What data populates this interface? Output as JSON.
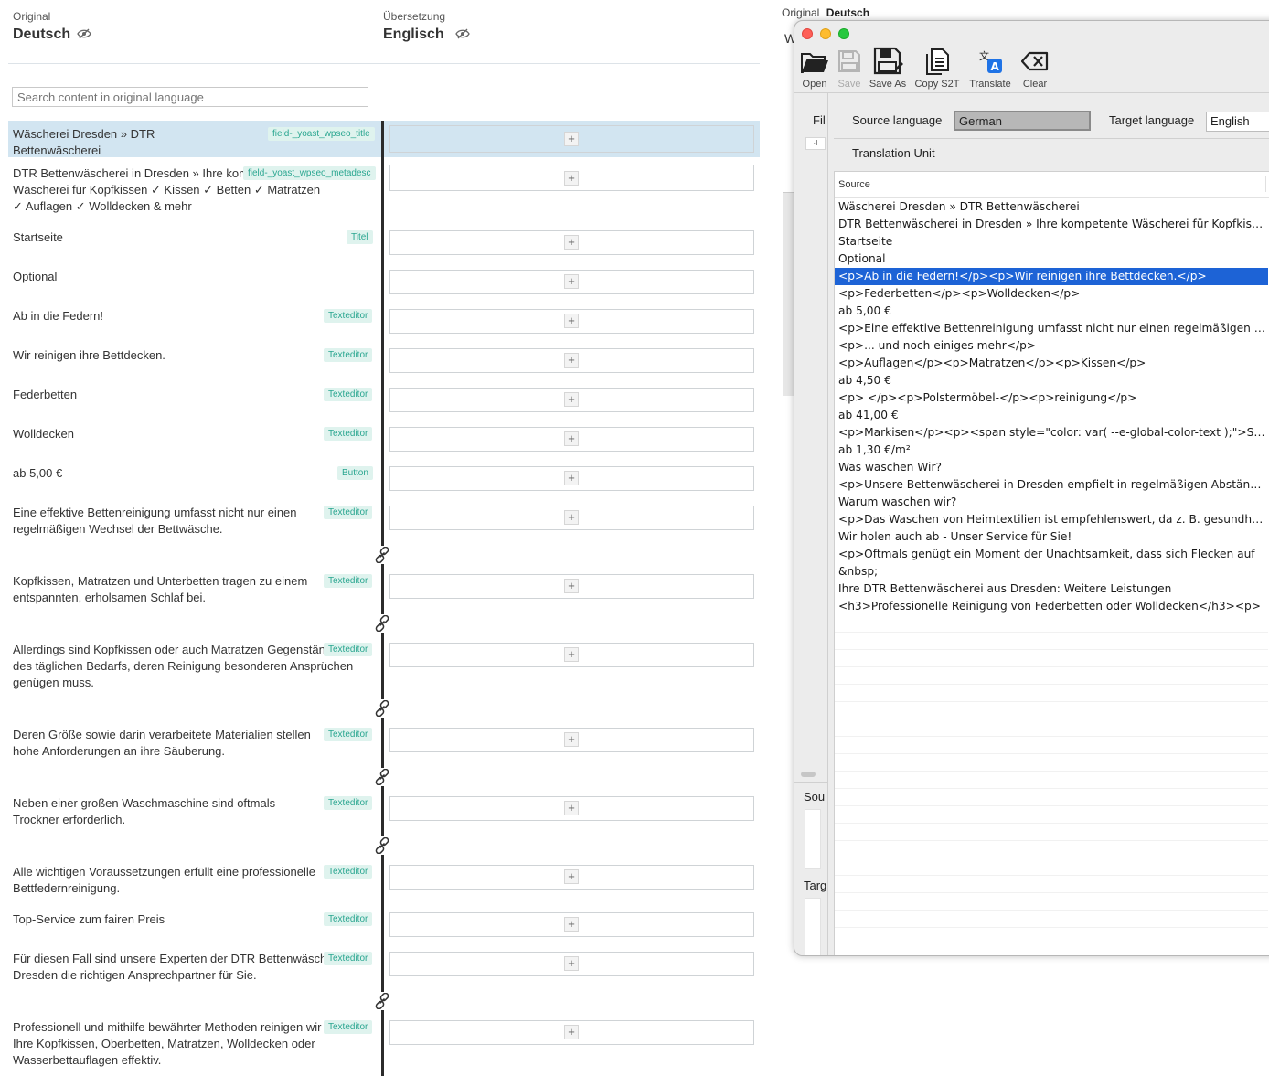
{
  "header": {
    "original_label": "Original",
    "original_lang": "Deutsch",
    "translation_label": "Übersetzung",
    "translation_lang": "Englisch"
  },
  "search": {
    "placeholder": "Search content in original language"
  },
  "segments": [
    {
      "text": "Wäscherei Dresden » DTR Bettenwäscherei",
      "tag": "field-_yoast_wpseo_title"
    },
    {
      "text": "DTR Bettenwäscherei in Dresden » Ihre kompetente Wäscherei für Kopfkissen ✓ Kissen ✓ Betten ✓ Matratzen ✓ Auflagen ✓ Wolldecken & mehr",
      "tag": "field-_yoast_wpseo_metadesc"
    },
    {
      "text": "Startseite",
      "tag": "Titel"
    },
    {
      "text": "Optional",
      "tag": ""
    },
    {
      "text": "Ab in die Federn!",
      "tag": "Texteditor"
    },
    {
      "text": "Wir reinigen ihre Bettdecken.",
      "tag": "Texteditor"
    },
    {
      "text": "Federbetten",
      "tag": "Texteditor"
    },
    {
      "text": "Wolldecken",
      "tag": "Texteditor"
    },
    {
      "text": "ab 5,00 €",
      "tag": "Button"
    },
    {
      "text": "Eine effektive Bettenreinigung umfasst nicht nur einen regelmäßigen Wechsel der Bettwäsche.",
      "tag": "Texteditor"
    },
    {
      "text": "Kopfkissen, Matratzen und Unterbetten tragen zu einem entspannten, erholsamen Schlaf bei.",
      "tag": "Texteditor"
    },
    {
      "text": "Allerdings sind Kopfkissen oder auch Matratzen Gegenstände des täglichen Bedarfs, deren Reinigung besonderen Ansprüchen genügen muss.",
      "tag": "Texteditor"
    },
    {
      "text": "Deren Größe sowie darin verarbeitete Materialien stellen hohe Anforderungen an ihre Säuberung.",
      "tag": "Texteditor"
    },
    {
      "text": "Neben einer großen Waschmaschine sind oftmals Trockner erforderlich.",
      "tag": "Texteditor"
    },
    {
      "text": "Alle wichtigen Voraussetzungen erfüllt eine professionelle Bettfedernreinigung.",
      "tag": "Texteditor"
    },
    {
      "text": "Top-Service zum fairen Preis",
      "tag": "Texteditor"
    },
    {
      "text": "Für diesen Fall sind unsere Experten der DTR Bettenwäscherei in Dresden die richtigen Ansprechpartner für Sie.",
      "tag": "Texteditor"
    },
    {
      "text": "Professionell und mithilfe bewährter Methoden reinigen wir Ihre Kopfkissen, Oberbetten, Matratzen, Wolldecken oder Wasserbettauflagen effektiv.",
      "tag": "Texteditor"
    }
  ],
  "plus_label": "+",
  "app": {
    "behind_title_label": "Original",
    "behind_title_lang": "Deutsch",
    "toolbar": {
      "open": "Open",
      "save": "Save",
      "save_as": "Save As",
      "copy_s2t": "Copy S2T",
      "translate": "Translate",
      "clear": "Clear"
    },
    "source_language_label": "Source language",
    "source_language_value": "German",
    "target_language_label": "Target language",
    "target_language_value": "English",
    "translation_unit_label": "Translation Unit",
    "source_column_header": "Source",
    "side_fil": "Fil",
    "side_sou": "Sou",
    "side_targ": "Targ",
    "rows": [
      "Wäscherei Dresden » DTR Bettenwäscherei",
      "DTR Bettenwäscherei in Dresden » Ihre kompetente Wäscherei für Kopfkissen ✓ Kissen",
      "Startseite",
      "Optional",
      "<p>Ab in die Federn!</p><p>Wir reinigen ihre Bettdecken.</p>",
      "<p>Federbetten</p><p>Wolldecken</p>",
      "ab 5,00 €",
      "<p>Eine effektive Bettenreinigung umfasst nicht nur einen regelmäßigen Wechsel der Bettwäsche.",
      "<p>... und noch einiges mehr</p>",
      "<p>Auflagen</p><p>Matratzen</p><p>Kissen</p>",
      "ab 4,50 €",
      "<p> </p><p>Polstermöbel-</p><p>reinigung</p>",
      "ab 41,00 €",
      "<p>Markisen</p><p><span style=\"color: var( --e-global-color-text );\">Sonnenschutz",
      "ab 1,30 €/m²",
      "Was waschen Wir?",
      "<p>Unsere Bettenwäscherei in Dresden empfielt in regelmäßigen Abständen",
      "Warum waschen wir?",
      "<p>Das Waschen von Heimtextilien ist empfehlenswert, da z. B. gesundheitliche",
      "Wir holen auch ab - Unser Service für Sie!",
      "<p>Oftmals genügt ein Moment der Unachtsamkeit, dass sich Flecken auf",
      "&nbsp;",
      "Ihre DTR Bettenwäscherei aus Dresden: Weitere Leistungen",
      "<h3>Professionelle Reinigung von Federbetten oder Wolldecken</h3><p>"
    ],
    "selected_row": 4
  }
}
